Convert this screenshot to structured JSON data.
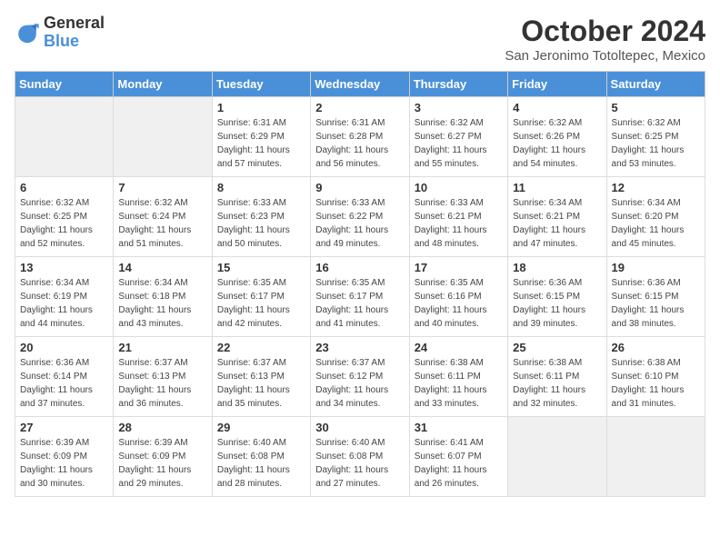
{
  "logo": {
    "general": "General",
    "blue": "Blue"
  },
  "title": "October 2024",
  "location": "San Jeronimo Totoltepec, Mexico",
  "days_of_week": [
    "Sunday",
    "Monday",
    "Tuesday",
    "Wednesday",
    "Thursday",
    "Friday",
    "Saturday"
  ],
  "weeks": [
    [
      {
        "day": "",
        "empty": true
      },
      {
        "day": "",
        "empty": true
      },
      {
        "day": "1",
        "sunrise": "6:31 AM",
        "sunset": "6:29 PM",
        "daylight": "11 hours and 57 minutes."
      },
      {
        "day": "2",
        "sunrise": "6:31 AM",
        "sunset": "6:28 PM",
        "daylight": "11 hours and 56 minutes."
      },
      {
        "day": "3",
        "sunrise": "6:32 AM",
        "sunset": "6:27 PM",
        "daylight": "11 hours and 55 minutes."
      },
      {
        "day": "4",
        "sunrise": "6:32 AM",
        "sunset": "6:26 PM",
        "daylight": "11 hours and 54 minutes."
      },
      {
        "day": "5",
        "sunrise": "6:32 AM",
        "sunset": "6:25 PM",
        "daylight": "11 hours and 53 minutes."
      }
    ],
    [
      {
        "day": "6",
        "sunrise": "6:32 AM",
        "sunset": "6:25 PM",
        "daylight": "11 hours and 52 minutes."
      },
      {
        "day": "7",
        "sunrise": "6:32 AM",
        "sunset": "6:24 PM",
        "daylight": "11 hours and 51 minutes."
      },
      {
        "day": "8",
        "sunrise": "6:33 AM",
        "sunset": "6:23 PM",
        "daylight": "11 hours and 50 minutes."
      },
      {
        "day": "9",
        "sunrise": "6:33 AM",
        "sunset": "6:22 PM",
        "daylight": "11 hours and 49 minutes."
      },
      {
        "day": "10",
        "sunrise": "6:33 AM",
        "sunset": "6:21 PM",
        "daylight": "11 hours and 48 minutes."
      },
      {
        "day": "11",
        "sunrise": "6:34 AM",
        "sunset": "6:21 PM",
        "daylight": "11 hours and 47 minutes."
      },
      {
        "day": "12",
        "sunrise": "6:34 AM",
        "sunset": "6:20 PM",
        "daylight": "11 hours and 45 minutes."
      }
    ],
    [
      {
        "day": "13",
        "sunrise": "6:34 AM",
        "sunset": "6:19 PM",
        "daylight": "11 hours and 44 minutes."
      },
      {
        "day": "14",
        "sunrise": "6:34 AM",
        "sunset": "6:18 PM",
        "daylight": "11 hours and 43 minutes."
      },
      {
        "day": "15",
        "sunrise": "6:35 AM",
        "sunset": "6:17 PM",
        "daylight": "11 hours and 42 minutes."
      },
      {
        "day": "16",
        "sunrise": "6:35 AM",
        "sunset": "6:17 PM",
        "daylight": "11 hours and 41 minutes."
      },
      {
        "day": "17",
        "sunrise": "6:35 AM",
        "sunset": "6:16 PM",
        "daylight": "11 hours and 40 minutes."
      },
      {
        "day": "18",
        "sunrise": "6:36 AM",
        "sunset": "6:15 PM",
        "daylight": "11 hours and 39 minutes."
      },
      {
        "day": "19",
        "sunrise": "6:36 AM",
        "sunset": "6:15 PM",
        "daylight": "11 hours and 38 minutes."
      }
    ],
    [
      {
        "day": "20",
        "sunrise": "6:36 AM",
        "sunset": "6:14 PM",
        "daylight": "11 hours and 37 minutes."
      },
      {
        "day": "21",
        "sunrise": "6:37 AM",
        "sunset": "6:13 PM",
        "daylight": "11 hours and 36 minutes."
      },
      {
        "day": "22",
        "sunrise": "6:37 AM",
        "sunset": "6:13 PM",
        "daylight": "11 hours and 35 minutes."
      },
      {
        "day": "23",
        "sunrise": "6:37 AM",
        "sunset": "6:12 PM",
        "daylight": "11 hours and 34 minutes."
      },
      {
        "day": "24",
        "sunrise": "6:38 AM",
        "sunset": "6:11 PM",
        "daylight": "11 hours and 33 minutes."
      },
      {
        "day": "25",
        "sunrise": "6:38 AM",
        "sunset": "6:11 PM",
        "daylight": "11 hours and 32 minutes."
      },
      {
        "day": "26",
        "sunrise": "6:38 AM",
        "sunset": "6:10 PM",
        "daylight": "11 hours and 31 minutes."
      }
    ],
    [
      {
        "day": "27",
        "sunrise": "6:39 AM",
        "sunset": "6:09 PM",
        "daylight": "11 hours and 30 minutes."
      },
      {
        "day": "28",
        "sunrise": "6:39 AM",
        "sunset": "6:09 PM",
        "daylight": "11 hours and 29 minutes."
      },
      {
        "day": "29",
        "sunrise": "6:40 AM",
        "sunset": "6:08 PM",
        "daylight": "11 hours and 28 minutes."
      },
      {
        "day": "30",
        "sunrise": "6:40 AM",
        "sunset": "6:08 PM",
        "daylight": "11 hours and 27 minutes."
      },
      {
        "day": "31",
        "sunrise": "6:41 AM",
        "sunset": "6:07 PM",
        "daylight": "11 hours and 26 minutes."
      },
      {
        "day": "",
        "empty": true
      },
      {
        "day": "",
        "empty": true
      }
    ]
  ],
  "labels": {
    "sunrise": "Sunrise:",
    "sunset": "Sunset:",
    "daylight": "Daylight:"
  }
}
